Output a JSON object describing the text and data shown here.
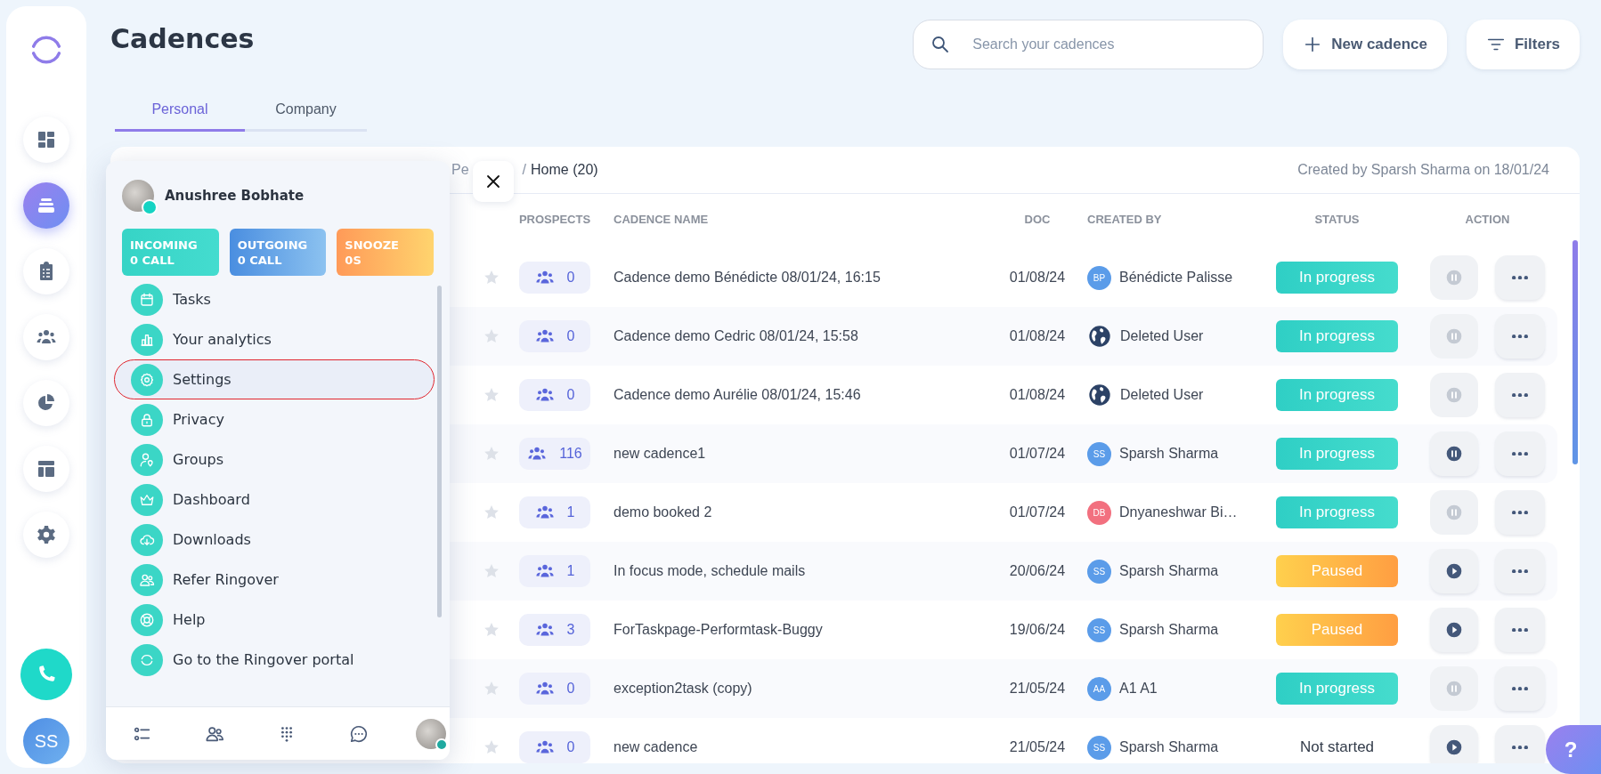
{
  "rail": {
    "items": [
      {
        "selected": false
      },
      {
        "selected": true
      },
      {
        "selected": false
      },
      {
        "selected": false
      },
      {
        "selected": false
      },
      {
        "selected": false
      },
      {
        "selected": false
      }
    ],
    "user": {
      "initials": "SS"
    }
  },
  "page": {
    "title": "Cadences"
  },
  "search": {
    "placeholder": "Search your cadences"
  },
  "buttons": [
    {
      "label": "New cadence",
      "kind": "add"
    },
    {
      "label": "Filters",
      "kind": "filter"
    }
  ],
  "tabs": [
    {
      "label": "Personal",
      "selected": true
    },
    {
      "label": "Company",
      "selected": false
    }
  ],
  "table": {
    "breadcrumb": [
      "Pe",
      "Home (20)"
    ],
    "separator": "/",
    "created_note": "Created by Sparsh Sharma on 18/01/24",
    "columns": [
      "PROSPECTS",
      "CADENCE NAME",
      "DOC",
      "CREATED BY",
      "STATUS",
      "ACTION"
    ],
    "rows": [
      {
        "prospects": "0",
        "name": "Cadence demo Bénédicte 08/01/24, 16:15",
        "doc": "01/08/24",
        "creator": {
          "kind": "initials",
          "initials": "BP",
          "name": "Bénédicte Palisse",
          "color": "#5b9ce9"
        },
        "status": {
          "label": "In progress",
          "kind": "in_progress"
        },
        "action": {
          "kind": "pause",
          "disabled": true
        }
      },
      {
        "prospects": "0",
        "name": "Cadence demo Cedric 08/01/24, 15:58",
        "doc": "01/08/24",
        "creator": {
          "kind": "deleted",
          "name": "Deleted User"
        },
        "status": {
          "label": "In progress",
          "kind": "in_progress"
        },
        "action": {
          "kind": "pause",
          "disabled": true
        }
      },
      {
        "prospects": "0",
        "name": "Cadence demo Aurélie 08/01/24, 15:46",
        "doc": "01/08/24",
        "creator": {
          "kind": "deleted",
          "name": "Deleted User"
        },
        "status": {
          "label": "In progress",
          "kind": "in_progress"
        },
        "action": {
          "kind": "pause",
          "disabled": true
        }
      },
      {
        "prospects": "116",
        "name": "new cadence1",
        "doc": "01/07/24",
        "creator": {
          "kind": "initials",
          "initials": "SS",
          "name": "Sparsh Sharma",
          "color": "#5b9ce9"
        },
        "status": {
          "label": "In progress",
          "kind": "in_progress"
        },
        "action": {
          "kind": "pause",
          "disabled": false
        }
      },
      {
        "prospects": "1",
        "name": "demo booked 2",
        "doc": "01/07/24",
        "creator": {
          "kind": "initials",
          "initials": "DB",
          "name": "Dnyaneshwar Bi…",
          "color": "#f2707f"
        },
        "status": {
          "label": "In progress",
          "kind": "in_progress"
        },
        "action": {
          "kind": "pause",
          "disabled": true
        }
      },
      {
        "prospects": "1",
        "name": "In focus mode, schedule mails",
        "doc": "20/06/24",
        "creator": {
          "kind": "initials",
          "initials": "SS",
          "name": "Sparsh Sharma",
          "color": "#5b9ce9"
        },
        "status": {
          "label": "Paused",
          "kind": "paused"
        },
        "action": {
          "kind": "play",
          "disabled": false
        }
      },
      {
        "prospects": "3",
        "name": "ForTaskpage-Performtask-Buggy",
        "doc": "19/06/24",
        "creator": {
          "kind": "initials",
          "initials": "SS",
          "name": "Sparsh Sharma",
          "color": "#5b9ce9"
        },
        "status": {
          "label": "Paused",
          "kind": "paused"
        },
        "action": {
          "kind": "play",
          "disabled": false
        }
      },
      {
        "prospects": "0",
        "name": "exception2task (copy)",
        "doc": "21/05/24",
        "creator": {
          "kind": "initials",
          "initials": "AA",
          "name": "A1 A1",
          "color": "#5b9ce9"
        },
        "status": {
          "label": "In progress",
          "kind": "in_progress"
        },
        "action": {
          "kind": "pause",
          "disabled": true
        }
      },
      {
        "prospects": "0",
        "name": "new cadence",
        "doc": "21/05/24",
        "creator": {
          "kind": "initials",
          "initials": "SS",
          "name": "Sparsh Sharma",
          "color": "#5b9ce9"
        },
        "status": {
          "label": "Not started",
          "kind": "not_started"
        },
        "action": {
          "kind": "play",
          "disabled": false
        }
      }
    ]
  },
  "popup": {
    "user": {
      "name": "Anushree Bobhate",
      "online": true
    },
    "counters": [
      {
        "title": "INCOMING",
        "value": "0 CALL",
        "kind": "incoming"
      },
      {
        "title": "OUTGOING",
        "value": "0 CALL",
        "kind": "outgoing"
      },
      {
        "title": "SNOOZE",
        "value": "0S",
        "kind": "snooze"
      }
    ],
    "menu": [
      {
        "label": "Tasks",
        "selected": false
      },
      {
        "label": "Your analytics",
        "selected": false
      },
      {
        "label": "Settings",
        "selected": true
      },
      {
        "label": "Privacy",
        "selected": false
      },
      {
        "label": "Groups",
        "selected": false
      },
      {
        "label": "Dashboard",
        "selected": false
      },
      {
        "label": "Downloads",
        "selected": false
      },
      {
        "label": "Refer Ringover",
        "selected": false
      },
      {
        "label": "Help",
        "selected": false
      },
      {
        "label": "Go to the Ringover portal",
        "selected": false
      }
    ]
  },
  "help_button": {
    "label": "?"
  }
}
